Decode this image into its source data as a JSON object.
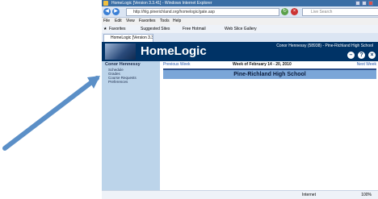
{
  "window": {
    "title": "HomeLogic  [Version 3.3.41] - Windows Internet Explorer"
  },
  "address_bar": {
    "url": "http://hlg.pinerichland.org/homelogic/gate.asp",
    "search_placeholder": "Live Search"
  },
  "menu": [
    "File",
    "Edit",
    "View",
    "Favorites",
    "Tools",
    "Help"
  ],
  "favorites_bar": {
    "favorites_label": "Favorites",
    "items": [
      "Suggested Sites",
      "Free Hotmail",
      "Web Slice Gallery"
    ]
  },
  "tab": {
    "label": "HomeLogic  [Version 3.3.41]"
  },
  "header": {
    "logo_text": "HomeLogic",
    "user": "Conor Hennessy (58938) - Pine-Richland High School",
    "buttons": [
      "–",
      "?",
      "×"
    ]
  },
  "sidebar": {
    "title": "Conor Hennessy",
    "items": [
      "Schedule",
      "Grades",
      "Course Requests",
      "Preferences"
    ]
  },
  "content": {
    "prev_label": "Previous Week",
    "week_label": "Week of February 14 - 20, 2010",
    "next_label": "Next Week",
    "school_name": "Pine-Richland High School"
  },
  "status": {
    "zone": "Internet",
    "zoom": "100%"
  },
  "colors": {
    "header_bg": "#003366",
    "sidebar_bg": "#bcd4ea",
    "school_bar": "#7ba6d8",
    "arrow": "#5b8fc7"
  }
}
